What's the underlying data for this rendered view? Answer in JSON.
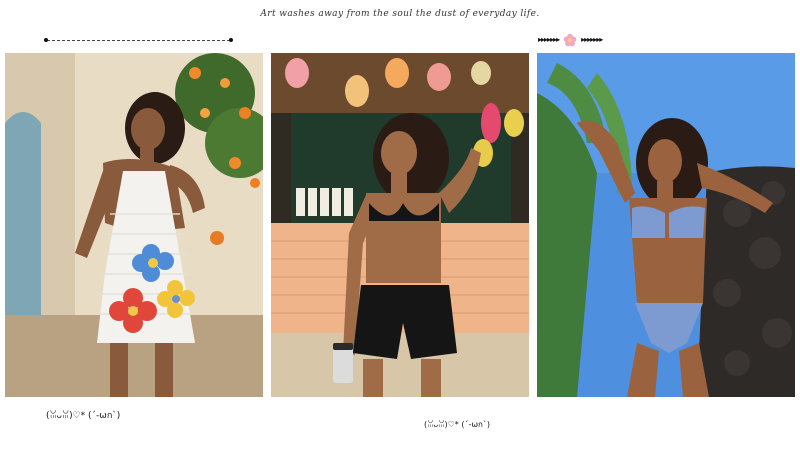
{
  "header": {
    "quote": "Art washes away from the soul the dust of everyday life."
  },
  "decorations": {
    "left_divider": "dotted-line",
    "right_divider_icon": "pink-flower-icon",
    "right_arrows_left": "▸▸▸▸▸▸▸",
    "right_arrows_right": "▸▸▸▸▸▸▸"
  },
  "photos": [
    {
      "subject": "woman in white crochet halter dress with flower appliqués",
      "scene": "sunlit stucco wall with orange flowers"
    },
    {
      "subject": "woman in black bikini top and black swim shorts holding a tumbler",
      "scene": "fruit stand with hanging nets"
    },
    {
      "subject": "woman in blue denim-print bikini",
      "scene": "blue sky, palm fronds and dark lava rock wall"
    }
  ],
  "captions": {
    "left": "(ꈍᴗꈍ)♡*  (´-ωก`)",
    "right": "(ꈍᴗꈍ)♡*  (´-ωก`)"
  },
  "colors": {
    "accent_pink": "#f2a6c8",
    "crochet_white": "#f4f2ee",
    "swim_black": "#151515",
    "denim_blue": "#7d9bd0",
    "sky_blue": "#4f8fe0",
    "stall_peach": "#efb48a"
  }
}
